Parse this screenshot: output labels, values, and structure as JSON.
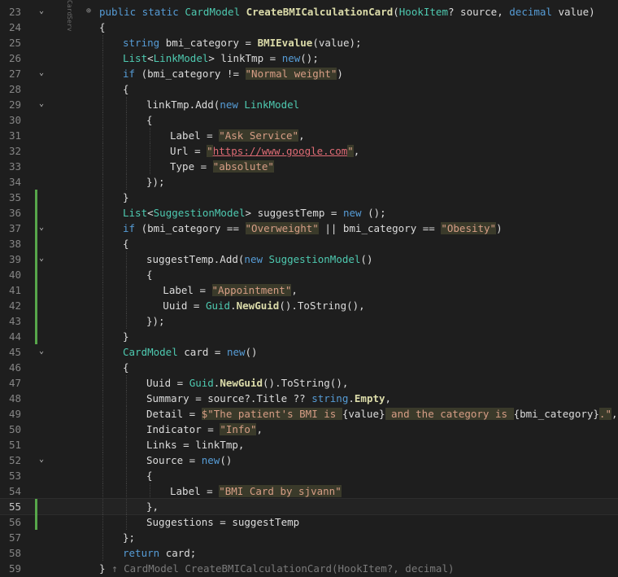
{
  "editor": {
    "side_label": "CardServ",
    "current_line": 55,
    "colors": {
      "background": "#1e1e1e",
      "keyword": "#569cd6",
      "type": "#4ec9b0",
      "method": "#dcdcaa",
      "string": "#d69d85",
      "change_marker": "#57a64a"
    },
    "lines": [
      {
        "n": 23,
        "fold": true,
        "changed": false,
        "indent": 0,
        "tokens": [
          [
            "public static ",
            "kw"
          ],
          [
            "CardModel ",
            "type"
          ],
          [
            "CreateBMICalculationCard",
            "meth"
          ],
          [
            "(",
            "plain"
          ],
          [
            "HookItem",
            "type"
          ],
          [
            "? source, ",
            "plain"
          ],
          [
            "decimal ",
            "kw"
          ],
          [
            "value)",
            "plain"
          ]
        ]
      },
      {
        "n": 24,
        "fold": false,
        "changed": false,
        "indent": 0,
        "tokens": [
          [
            "{",
            "plain"
          ]
        ]
      },
      {
        "n": 25,
        "fold": false,
        "changed": false,
        "indent": 1,
        "tokens": [
          [
            "string ",
            "kw"
          ],
          [
            "bmi_category = ",
            "plain"
          ],
          [
            "BMIEvalue",
            "meth"
          ],
          [
            "(value);",
            "plain"
          ]
        ]
      },
      {
        "n": 26,
        "fold": false,
        "changed": false,
        "indent": 1,
        "tokens": [
          [
            "List",
            "type"
          ],
          [
            "<",
            "plain"
          ],
          [
            "LinkModel",
            "type"
          ],
          [
            "> linkTmp = ",
            "plain"
          ],
          [
            "new",
            "kw"
          ],
          [
            "();",
            "plain"
          ]
        ]
      },
      {
        "n": 27,
        "fold": true,
        "changed": false,
        "indent": 1,
        "tokens": [
          [
            "if ",
            "kw"
          ],
          [
            "(bmi_category != ",
            "plain"
          ],
          [
            "\"Normal weight\"",
            "str"
          ],
          [
            ")",
            "plain"
          ]
        ]
      },
      {
        "n": 28,
        "fold": false,
        "changed": false,
        "indent": 1,
        "tokens": [
          [
            "{",
            "plain"
          ]
        ]
      },
      {
        "n": 29,
        "fold": true,
        "changed": false,
        "indent": 2,
        "tokens": [
          [
            "linkTmp.Add(",
            "plain"
          ],
          [
            "new ",
            "kw"
          ],
          [
            "LinkModel",
            "type"
          ]
        ]
      },
      {
        "n": 30,
        "fold": false,
        "changed": false,
        "indent": 2,
        "tokens": [
          [
            "{",
            "plain"
          ]
        ]
      },
      {
        "n": 31,
        "fold": false,
        "changed": false,
        "indent": 3,
        "tokens": [
          [
            "Label = ",
            "plain"
          ],
          [
            "\"Ask Service\"",
            "str"
          ],
          [
            ",",
            "plain"
          ]
        ]
      },
      {
        "n": 32,
        "fold": false,
        "changed": false,
        "indent": 3,
        "tokens": [
          [
            "Url = ",
            "plain"
          ],
          [
            "\"",
            "str"
          ],
          [
            "https://www.google.com",
            "link"
          ],
          [
            "\"",
            "str"
          ],
          [
            ",",
            "plain"
          ]
        ]
      },
      {
        "n": 33,
        "fold": false,
        "changed": false,
        "indent": 3,
        "tokens": [
          [
            "Type = ",
            "plain"
          ],
          [
            "\"absolute\"",
            "str"
          ]
        ]
      },
      {
        "n": 34,
        "fold": false,
        "changed": false,
        "indent": 2,
        "tokens": [
          [
            "});",
            "plain"
          ]
        ]
      },
      {
        "n": 35,
        "fold": false,
        "changed": true,
        "indent": 1,
        "tokens": [
          [
            "}",
            "plain"
          ]
        ]
      },
      {
        "n": 36,
        "fold": false,
        "changed": true,
        "indent": 1,
        "tokens": [
          [
            "List",
            "type"
          ],
          [
            "<",
            "plain"
          ],
          [
            "SuggestionModel",
            "type"
          ],
          [
            "> suggestTemp = ",
            "plain"
          ],
          [
            "new ",
            "kw"
          ],
          [
            "();",
            "plain"
          ]
        ]
      },
      {
        "n": 37,
        "fold": true,
        "changed": true,
        "indent": 1,
        "tokens": [
          [
            "if ",
            "kw"
          ],
          [
            "(bmi_category == ",
            "plain"
          ],
          [
            "\"Overweight\"",
            "str"
          ],
          [
            " || bmi_category == ",
            "plain"
          ],
          [
            "\"Obesity\"",
            "str"
          ],
          [
            ")",
            "plain"
          ]
        ]
      },
      {
        "n": 38,
        "fold": false,
        "changed": true,
        "indent": 1,
        "tokens": [
          [
            "{",
            "plain"
          ]
        ]
      },
      {
        "n": 39,
        "fold": true,
        "changed": true,
        "indent": 2,
        "tokens": [
          [
            "suggestTemp.Add(",
            "plain"
          ],
          [
            "new ",
            "kw"
          ],
          [
            "SuggestionModel",
            "type"
          ],
          [
            "()",
            "plain"
          ]
        ]
      },
      {
        "n": 40,
        "fold": false,
        "changed": true,
        "indent": 2,
        "tokens": [
          [
            "{",
            "plain"
          ]
        ]
      },
      {
        "n": 41,
        "fold": false,
        "changed": true,
        "indent": 2.7,
        "tokens": [
          [
            "Label = ",
            "plain"
          ],
          [
            "\"Appointment\"",
            "str"
          ],
          [
            ",",
            "plain"
          ]
        ]
      },
      {
        "n": 42,
        "fold": false,
        "changed": true,
        "indent": 2.7,
        "tokens": [
          [
            "Uuid = ",
            "plain"
          ],
          [
            "Guid",
            "type"
          ],
          [
            ".",
            "plain"
          ],
          [
            "NewGuid",
            "meth"
          ],
          [
            "().ToString(),",
            "plain"
          ]
        ]
      },
      {
        "n": 43,
        "fold": false,
        "changed": true,
        "indent": 2,
        "tokens": [
          [
            "});",
            "plain"
          ]
        ]
      },
      {
        "n": 44,
        "fold": false,
        "changed": true,
        "indent": 1,
        "tokens": [
          [
            "}",
            "plain"
          ]
        ]
      },
      {
        "n": 45,
        "fold": true,
        "changed": false,
        "indent": 1,
        "tokens": [
          [
            "CardModel ",
            "type"
          ],
          [
            "card = ",
            "plain"
          ],
          [
            "new",
            "kw"
          ],
          [
            "()",
            "plain"
          ]
        ]
      },
      {
        "n": 46,
        "fold": false,
        "changed": false,
        "indent": 1,
        "tokens": [
          [
            "{",
            "plain"
          ]
        ]
      },
      {
        "n": 47,
        "fold": false,
        "changed": false,
        "indent": 2,
        "tokens": [
          [
            "Uuid = ",
            "plain"
          ],
          [
            "Guid",
            "type"
          ],
          [
            ".",
            "plain"
          ],
          [
            "NewGuid",
            "meth"
          ],
          [
            "().ToString(),",
            "plain"
          ]
        ]
      },
      {
        "n": 48,
        "fold": false,
        "changed": false,
        "indent": 2,
        "tokens": [
          [
            "Summary = source?.Title ?? ",
            "plain"
          ],
          [
            "string",
            "kw"
          ],
          [
            ".",
            "plain"
          ],
          [
            "Empty",
            "meth"
          ],
          [
            ",",
            "plain"
          ]
        ]
      },
      {
        "n": 49,
        "fold": false,
        "changed": false,
        "indent": 2,
        "tokens": [
          [
            "Detail = ",
            "plain"
          ],
          [
            "$\"The patient's BMI is ",
            "str"
          ],
          [
            "{value}",
            "plain"
          ],
          [
            " and the category is ",
            "str"
          ],
          [
            "{bmi_category}",
            "plain"
          ],
          [
            ".\"",
            "str"
          ],
          [
            ",",
            "plain"
          ]
        ]
      },
      {
        "n": 50,
        "fold": false,
        "changed": false,
        "indent": 2,
        "tokens": [
          [
            "Indicator = ",
            "plain"
          ],
          [
            "\"Info\"",
            "str"
          ],
          [
            ",",
            "plain"
          ]
        ]
      },
      {
        "n": 51,
        "fold": false,
        "changed": false,
        "indent": 2,
        "tokens": [
          [
            "Links = linkTmp,",
            "plain"
          ]
        ]
      },
      {
        "n": 52,
        "fold": true,
        "changed": false,
        "indent": 2,
        "tokens": [
          [
            "Source = ",
            "plain"
          ],
          [
            "new",
            "kw"
          ],
          [
            "()",
            "plain"
          ]
        ]
      },
      {
        "n": 53,
        "fold": false,
        "changed": false,
        "indent": 2,
        "tokens": [
          [
            "{",
            "plain"
          ]
        ]
      },
      {
        "n": 54,
        "fold": false,
        "changed": false,
        "indent": 3,
        "tokens": [
          [
            "Label = ",
            "plain"
          ],
          [
            "\"BMI Card by sjvann\"",
            "str"
          ]
        ]
      },
      {
        "n": 55,
        "fold": false,
        "changed": true,
        "indent": 2,
        "tokens": [
          [
            "},",
            "plain"
          ]
        ]
      },
      {
        "n": 56,
        "fold": false,
        "changed": true,
        "indent": 2,
        "tokens": [
          [
            "Suggestions = suggestTemp",
            "plain"
          ]
        ]
      },
      {
        "n": 57,
        "fold": false,
        "changed": false,
        "indent": 1,
        "tokens": [
          [
            "};",
            "plain"
          ]
        ]
      },
      {
        "n": 58,
        "fold": false,
        "changed": false,
        "indent": 1,
        "tokens": [
          [
            "return ",
            "kw"
          ],
          [
            "card;",
            "plain"
          ]
        ]
      },
      {
        "n": 59,
        "fold": false,
        "changed": false,
        "indent": 0,
        "tokens": [
          [
            "} ",
            "plain"
          ],
          [
            "↑ ",
            "dim"
          ],
          [
            "CardModel CreateBMICalculationCard(HookItem?, decimal)",
            "dim"
          ]
        ]
      }
    ]
  }
}
